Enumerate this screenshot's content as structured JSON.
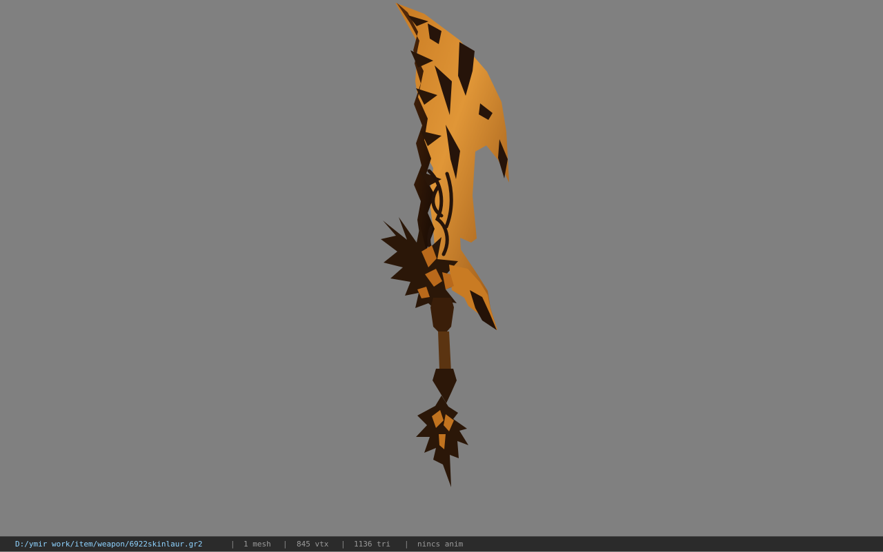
{
  "viewport": {
    "background_color": "#808080",
    "model": {
      "icon_name": "sword-model",
      "primary_color": "#d8892a",
      "shadow_color": "#2a1608"
    }
  },
  "status": {
    "path": "D:/ymir work/item/weapon/6922skinlaur.gr2",
    "separator": "|",
    "mesh": "1 mesh",
    "vertices": "845 vtx",
    "triangles": "1136 tri",
    "animation": "nincs anim"
  }
}
